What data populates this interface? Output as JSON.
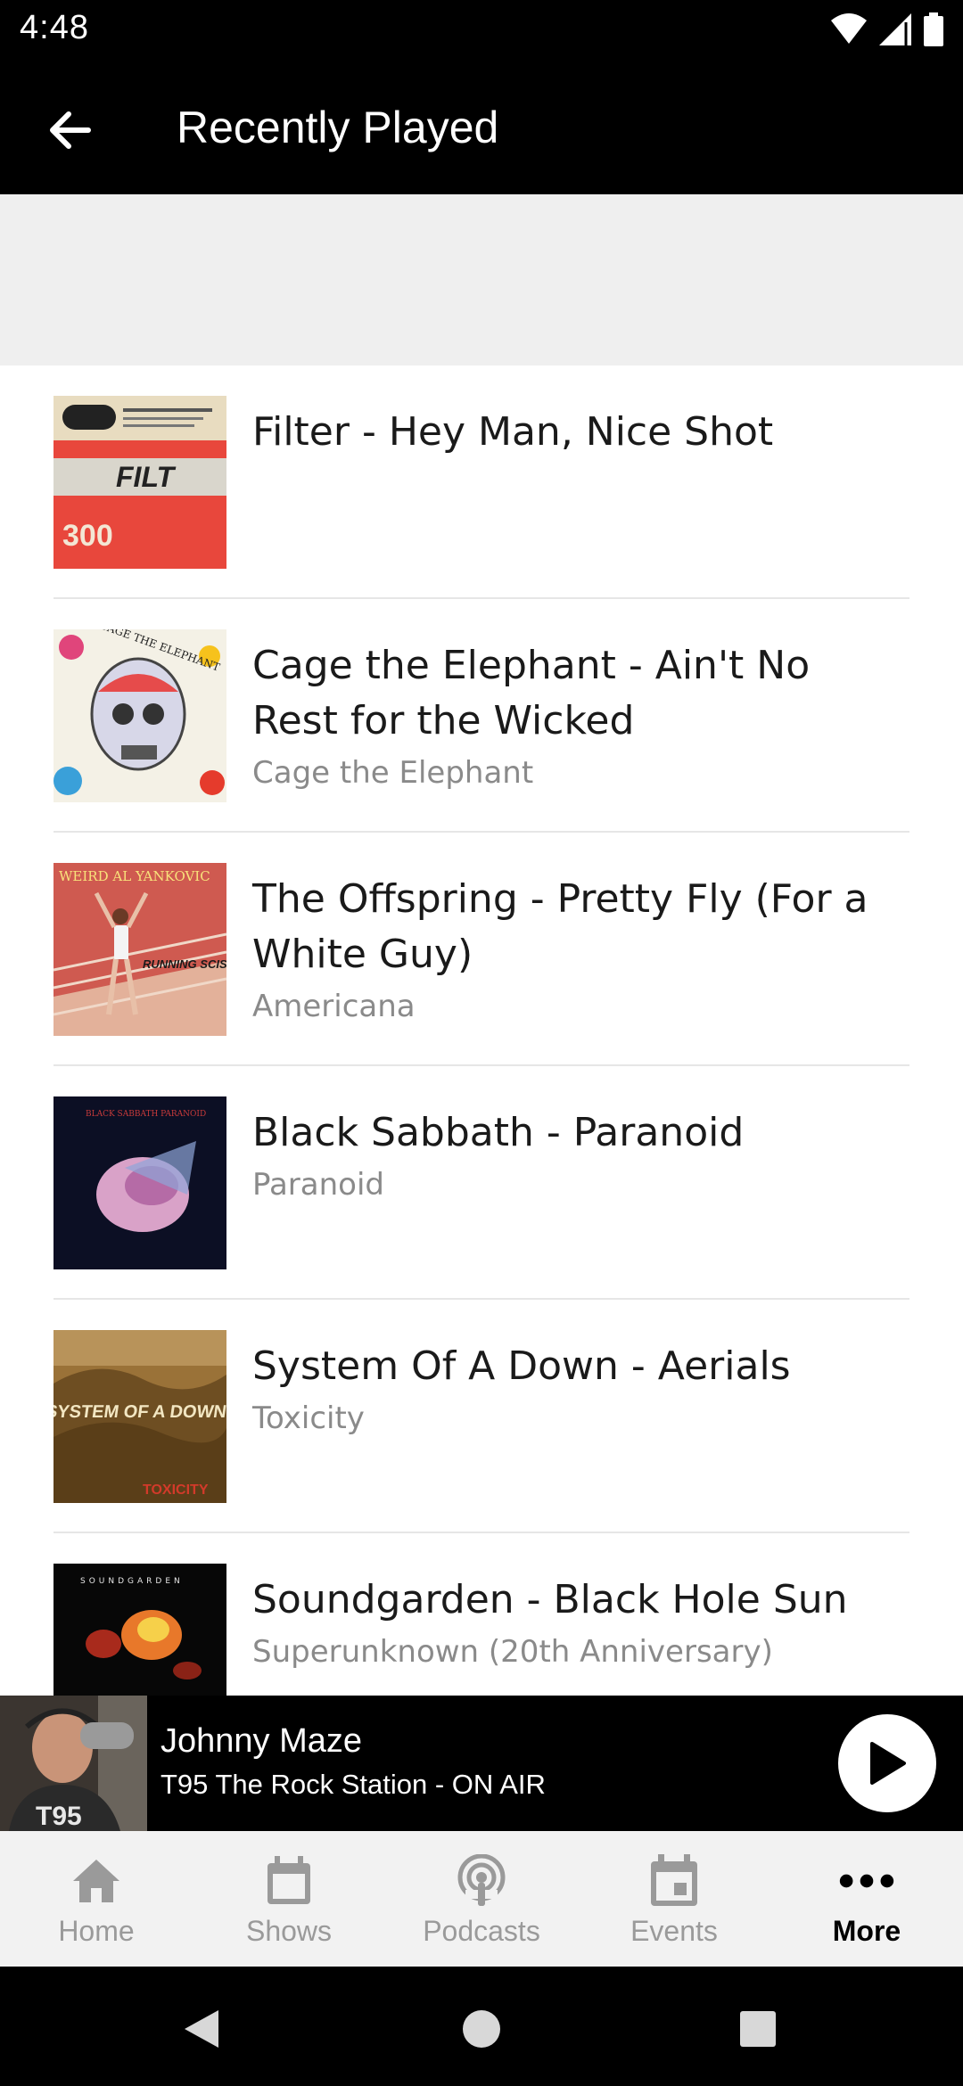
{
  "status_bar": {
    "time": "4:48"
  },
  "app_bar": {
    "title": "Recently Played"
  },
  "tracks": [
    {
      "title": "Filter - Hey Man, Nice Shot",
      "subtitle": ""
    },
    {
      "title": "Cage the Elephant - Ain't No Rest for the Wicked",
      "subtitle": "Cage the Elephant"
    },
    {
      "title": "The Offspring - Pretty Fly (For a White Guy)",
      "subtitle": "Americana"
    },
    {
      "title": "Black Sabbath - Paranoid",
      "subtitle": "Paranoid"
    },
    {
      "title": "System Of A Down - Aerials",
      "subtitle": "Toxicity"
    },
    {
      "title": "Soundgarden - Black Hole Sun",
      "subtitle": "Superunknown (20th Anniversary)"
    }
  ],
  "album_art_text": {
    "filter": "FILT",
    "filter_num": "300",
    "cage": "CAGE THE ELEPHANT",
    "offspring": "WEIRD AL YANKOVIC",
    "offspring_sub": "RUNNING SCISSORS",
    "sabbath": "BLACK SABBATH PARANOID",
    "soad": "SYSTEM OF A DOWN",
    "soad_sub": "TOXICITY",
    "soundgarden": "SOUNDGARDEN"
  },
  "player": {
    "host": "Johnny Maze",
    "station": "T95 The Rock Station - ON AIR",
    "shirt_text": "T95"
  },
  "bottom_nav": [
    {
      "label": "Home",
      "icon": "home-icon"
    },
    {
      "label": "Shows",
      "icon": "calendar-icon"
    },
    {
      "label": "Podcasts",
      "icon": "podcast-icon"
    },
    {
      "label": "Events",
      "icon": "event-icon"
    },
    {
      "label": "More",
      "icon": "more-icon"
    }
  ],
  "colors": {
    "bar_background": "#000000",
    "nav_background": "#f2f2f2",
    "active_nav": "#000000",
    "inactive_nav": "#9a9a9a"
  }
}
